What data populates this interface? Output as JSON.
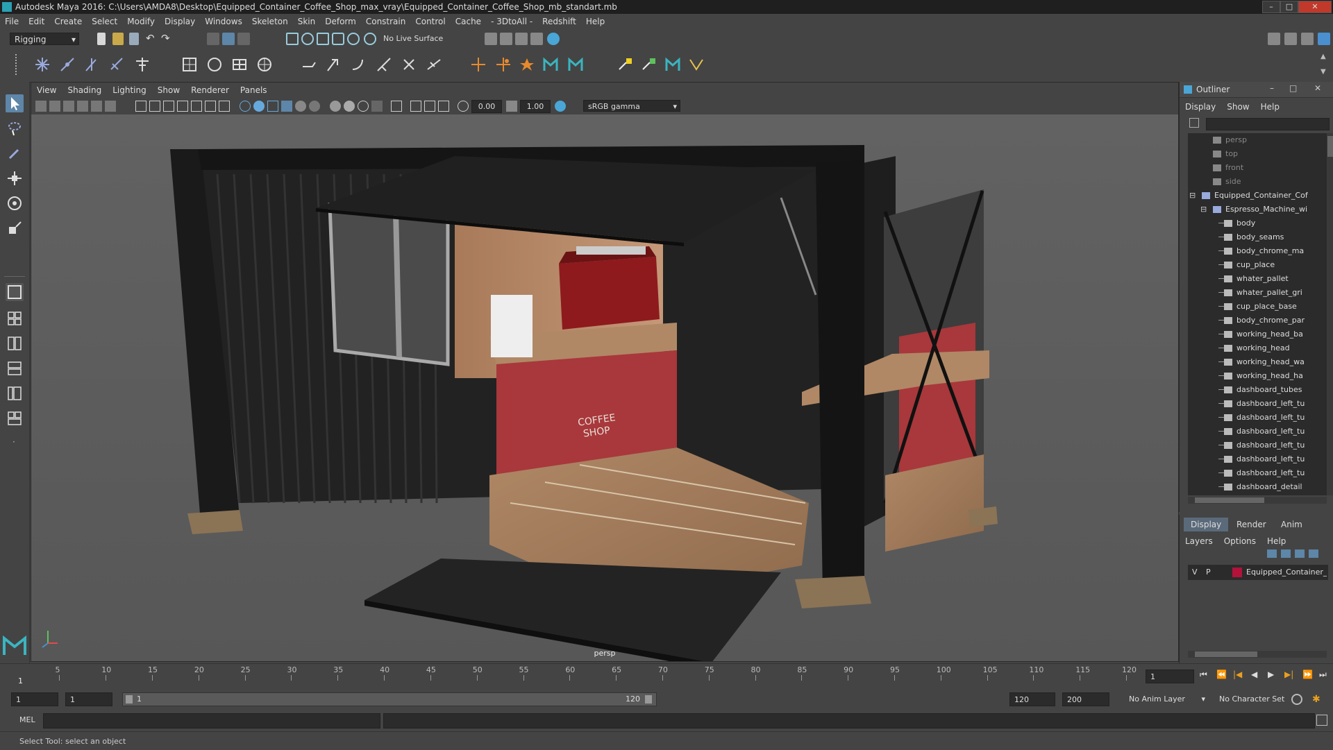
{
  "window": {
    "title": "Autodesk Maya 2016: C:\\Users\\AMDA8\\Desktop\\Equipped_Container_Coffee_Shop_max_vray\\Equipped_Container_Coffee_Shop_mb_standart.mb"
  },
  "menubar": {
    "items": [
      "File",
      "Edit",
      "Create",
      "Select",
      "Modify",
      "Display",
      "Windows",
      "Skeleton",
      "Skin",
      "Deform",
      "Constrain",
      "Control",
      "Cache",
      "- 3DtoAll -",
      "Redshift",
      "Help"
    ]
  },
  "statusline": {
    "mode": "Rigging",
    "live_surface": "No Live Surface"
  },
  "viewport": {
    "menu": [
      "View",
      "Shading",
      "Lighting",
      "Show",
      "Renderer",
      "Panels"
    ],
    "exposure": "0.00",
    "gamma": "1.00",
    "color_space": "sRGB gamma",
    "camera": "persp",
    "sign_text_line1": "COFFEE",
    "sign_text_line2": "SHOP"
  },
  "outliner": {
    "title": "Outliner",
    "menu": [
      "Display",
      "Show",
      "Help"
    ],
    "rows": [
      {
        "label": "persp",
        "dim": true,
        "indent": 1
      },
      {
        "label": "top",
        "dim": true,
        "indent": 1
      },
      {
        "label": "front",
        "dim": true,
        "indent": 1
      },
      {
        "label": "side",
        "dim": true,
        "indent": 1
      },
      {
        "label": "Equipped_Container_Cof",
        "dim": false,
        "indent": 0
      },
      {
        "label": "Espresso_Machine_wi",
        "dim": false,
        "indent": 1
      },
      {
        "label": "body",
        "dim": false,
        "indent": 2
      },
      {
        "label": "body_seams",
        "dim": false,
        "indent": 2
      },
      {
        "label": "body_chrome_ma",
        "dim": false,
        "indent": 2
      },
      {
        "label": "cup_place",
        "dim": false,
        "indent": 2
      },
      {
        "label": "whater_pallet",
        "dim": false,
        "indent": 2
      },
      {
        "label": "whater_pallet_gri",
        "dim": false,
        "indent": 2
      },
      {
        "label": "cup_place_base",
        "dim": false,
        "indent": 2
      },
      {
        "label": "body_chrome_par",
        "dim": false,
        "indent": 2
      },
      {
        "label": "working_head_ba",
        "dim": false,
        "indent": 2
      },
      {
        "label": "working_head",
        "dim": false,
        "indent": 2
      },
      {
        "label": "working_head_wa",
        "dim": false,
        "indent": 2
      },
      {
        "label": "working_head_ha",
        "dim": false,
        "indent": 2
      },
      {
        "label": "dashboard_tubes",
        "dim": false,
        "indent": 2
      },
      {
        "label": "dashboard_left_tu",
        "dim": false,
        "indent": 2
      },
      {
        "label": "dashboard_left_tu",
        "dim": false,
        "indent": 2
      },
      {
        "label": "dashboard_left_tu",
        "dim": false,
        "indent": 2
      },
      {
        "label": "dashboard_left_tu",
        "dim": false,
        "indent": 2
      },
      {
        "label": "dashboard_left_tu",
        "dim": false,
        "indent": 2
      },
      {
        "label": "dashboard_left_tu",
        "dim": false,
        "indent": 2
      },
      {
        "label": "dashboard_detail",
        "dim": false,
        "indent": 2
      }
    ]
  },
  "layers": {
    "tabs": [
      "Display",
      "Render",
      "Anim"
    ],
    "menu": [
      "Layers",
      "Options",
      "Help"
    ],
    "row": {
      "v": "V",
      "p": "P",
      "name": "Equipped_Container_C",
      "color": "#b3123a"
    }
  },
  "timeslider": {
    "ticks": [
      5,
      10,
      15,
      20,
      25,
      30,
      35,
      40,
      45,
      50,
      55,
      60,
      65,
      70,
      75,
      80,
      85,
      90,
      95,
      100,
      105,
      110,
      115,
      120
    ],
    "current_frame": "1",
    "start_marker": "1"
  },
  "range": {
    "start": "1",
    "playback_start": "1",
    "slider_start": "1",
    "slider_end": "120",
    "playback_end": "120",
    "end": "200",
    "anim_layer": "No Anim Layer",
    "character_set": "No Character Set"
  },
  "cmdline": {
    "label": "MEL"
  },
  "helpline": {
    "text": "Select Tool: select an object"
  }
}
